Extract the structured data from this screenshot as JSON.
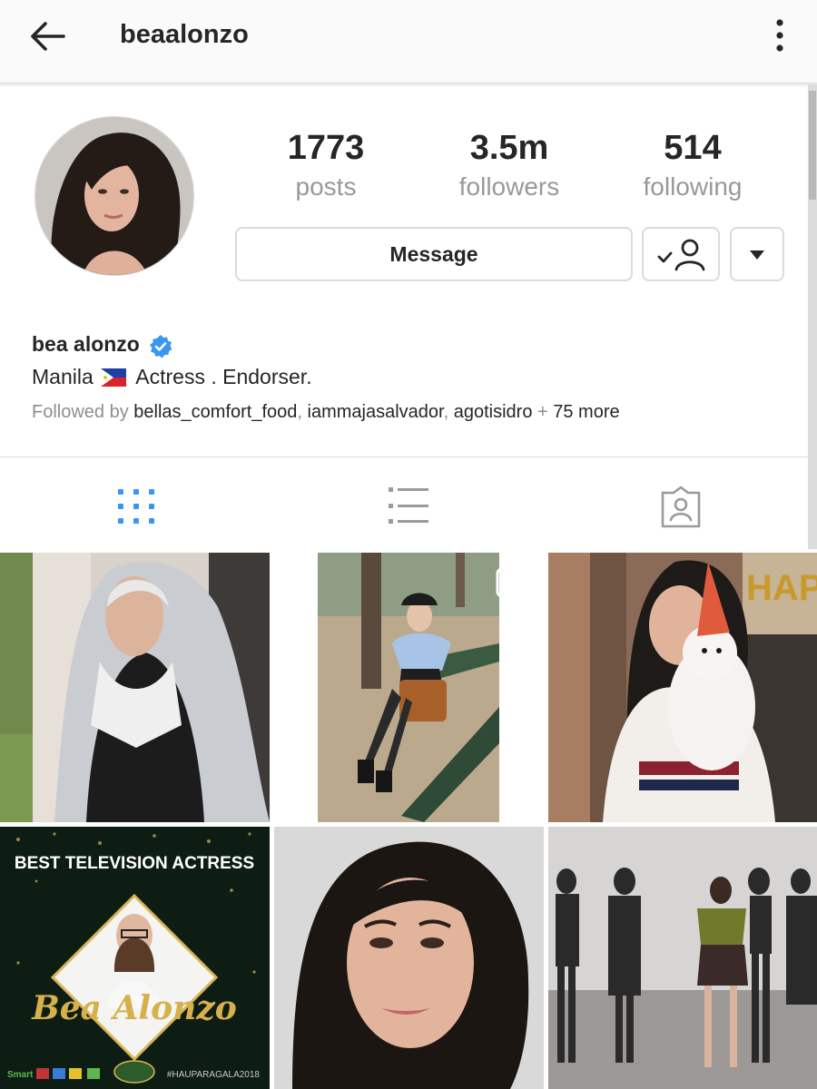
{
  "header": {
    "username": "beaalonzo"
  },
  "profile": {
    "stats": [
      {
        "value": "1773",
        "label": "posts"
      },
      {
        "value": "3.5m",
        "label": "followers"
      },
      {
        "value": "514",
        "label": "following"
      }
    ],
    "message_label": "Message"
  },
  "bio": {
    "name": "bea alonzo",
    "location": "Manila",
    "description": "Actress . Endorser.",
    "followed_by_prefix": "Followed by",
    "followers_list": [
      "bellas_comfort_food",
      "iammajasalvador",
      "agotisidro"
    ],
    "separator": ", ",
    "plus": " + ",
    "more": "75 more"
  },
  "posts": {
    "post5_title": "BEST TELEVISION ACTRESS",
    "post5_script": "Bea Alonzo",
    "post5_tag": "#HAUPARAGALA2018",
    "post5_sponsor": "Smart",
    "post3_banner": "HAP"
  },
  "colors": {
    "verified_blue": "#3897f0",
    "active_tab": "#3897f0",
    "inactive_icon": "#9a9a9a"
  }
}
